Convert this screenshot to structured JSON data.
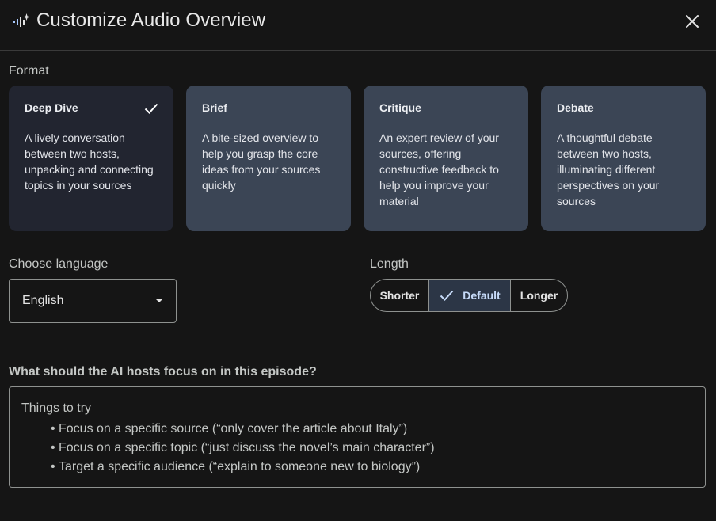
{
  "header": {
    "title": "Customize Audio Overview",
    "title_icon": "sparkle-audio-icon",
    "close_icon": "close-icon"
  },
  "format": {
    "label": "Format",
    "selected_index": 0,
    "cards": [
      {
        "title": "Deep Dive",
        "desc": "A lively conversation between two hosts, unpacking and connecting topics in your sources",
        "selected": true
      },
      {
        "title": "Brief",
        "desc": "A bite-sized overview to help you grasp the core ideas from your sources quickly",
        "selected": false
      },
      {
        "title": "Critique",
        "desc": "An expert review of your sources, offering constructive feedback to help you improve your material",
        "selected": false
      },
      {
        "title": "Debate",
        "desc": "A thoughtful debate between two hosts, illuminating different perspectives on your sources",
        "selected": false
      }
    ]
  },
  "language": {
    "label": "Choose language",
    "value": "English"
  },
  "length": {
    "label": "Length",
    "options": [
      "Shorter",
      "Default",
      "Longer"
    ],
    "selected": "Default"
  },
  "focus": {
    "label": "What should the AI hosts focus on in this episode?",
    "placeholder_title": "Things to try",
    "bullet": "•",
    "placeholder_items": [
      "Focus on a specific source (“only cover the article about Italy”)",
      "Focus on a specific topic (“just discuss the novel’s main character”)",
      "Target a specific audience (“explain to someone new to biology”)"
    ]
  },
  "colors": {
    "background": "#151515",
    "card": "#3b4555",
    "card_selected": "#222530",
    "segment_selected": "#2c3646",
    "accent_text": "#c6daf8"
  }
}
